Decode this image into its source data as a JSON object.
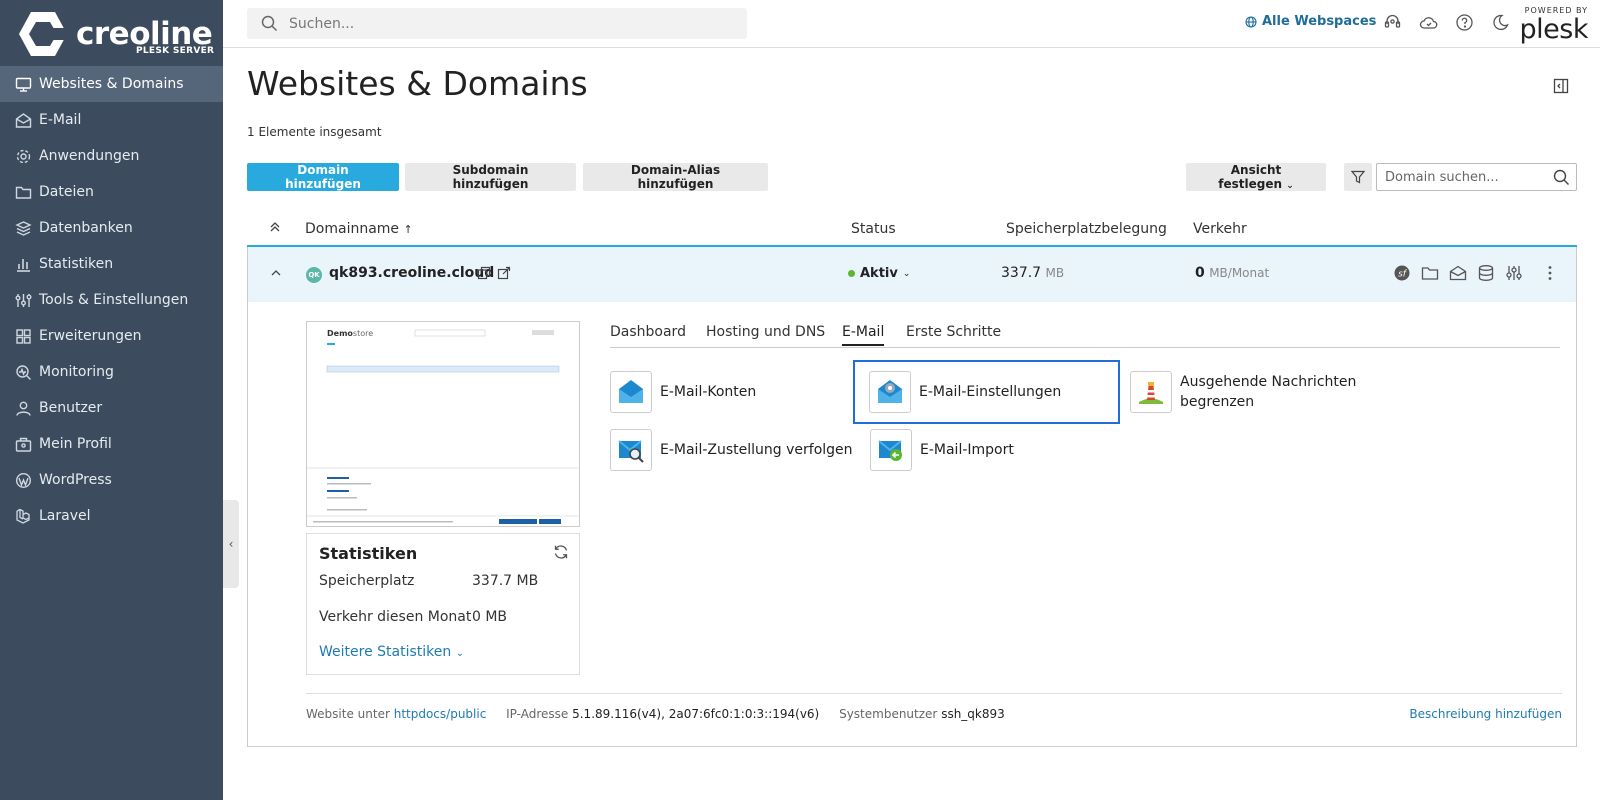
{
  "brand": {
    "name": "creoline",
    "sub": "PLESK SERVER"
  },
  "sidebar": {
    "items": [
      {
        "label": "Websites & Domains",
        "icon": "monitor-icon",
        "active": true
      },
      {
        "label": "E-Mail",
        "icon": "mail-icon"
      },
      {
        "label": "Anwendungen",
        "icon": "gear-icon"
      },
      {
        "label": "Dateien",
        "icon": "folder-icon"
      },
      {
        "label": "Datenbanken",
        "icon": "database-icon"
      },
      {
        "label": "Statistiken",
        "icon": "bar-chart-icon"
      },
      {
        "label": "Tools & Einstellungen",
        "icon": "tools-icon"
      },
      {
        "label": "Erweiterungen",
        "icon": "extensions-icon"
      },
      {
        "label": "Monitoring",
        "icon": "monitoring-icon"
      },
      {
        "label": "Benutzer",
        "icon": "user-icon"
      },
      {
        "label": "Mein Profil",
        "icon": "profile-icon"
      },
      {
        "label": "WordPress",
        "icon": "wordpress-icon"
      },
      {
        "label": "Laravel",
        "icon": "laravel-icon"
      }
    ]
  },
  "header": {
    "search_placeholder": "Suchen...",
    "webspaces_label": "Alle Webspaces",
    "powered_by": "POWERED BY",
    "plesk": "plesk"
  },
  "main": {
    "title": "Websites & Domains",
    "total": "1 Elemente insgesamt",
    "buttons": {
      "add_domain": "Domain hinzufügen",
      "add_subdomain": "Subdomain hinzufügen",
      "add_alias": "Domain-Alias hinzufügen",
      "view": "Ansicht festlegen"
    },
    "domain_search_placeholder": "Domain suchen...",
    "columns": {
      "domain": "Domainname",
      "status": "Status",
      "usage": "Speicherplatzbelegung",
      "traffic": "Verkehr"
    }
  },
  "domain": {
    "avatar": "QK",
    "name": "qk893.creoline.cloud",
    "status": "Aktiv",
    "usage_value": "337.7",
    "usage_unit": "MB",
    "traffic_value": "0",
    "traffic_unit": "MB/Monat"
  },
  "preview": {
    "site_name_a": "Demo",
    "site_name_b": "store"
  },
  "stats": {
    "title": "Statistiken",
    "disk_label": "Speicherplatz",
    "disk_value": "337.7 MB",
    "traffic_label": "Verkehr diesen Monat",
    "traffic_value": "0 MB",
    "more": "Weitere Statistiken"
  },
  "tabs": [
    {
      "label": "Dashboard"
    },
    {
      "label": "Hosting und DNS"
    },
    {
      "label": "E-Mail",
      "active": true
    },
    {
      "label": "Erste Schritte"
    }
  ],
  "tools": [
    {
      "label": "E-Mail-Konten"
    },
    {
      "label": "E-Mail-Einstellungen",
      "selected": true
    },
    {
      "label": "Ausgehende Nachrichten begrenzen"
    },
    {
      "label": "E-Mail-Zustellung verfolgen"
    },
    {
      "label": "E-Mail-Import"
    }
  ],
  "footer": {
    "website_label": "Website unter",
    "website_path": "httpdocs/public",
    "ip_label": "IP-Adresse",
    "ip_value": "5.1.89.116(v4), 2a07:6fc0:1:0:3::194(v6)",
    "user_label": "Systembenutzer",
    "user_value": "ssh_qk893",
    "add_description": "Beschreibung hinzufügen"
  },
  "colors": {
    "sidebar_bg": "#3c4c5e",
    "primary": "#28aade",
    "active_status": "#5ab82e",
    "link": "#1f7bb0",
    "selection": "#1f6fd6"
  }
}
